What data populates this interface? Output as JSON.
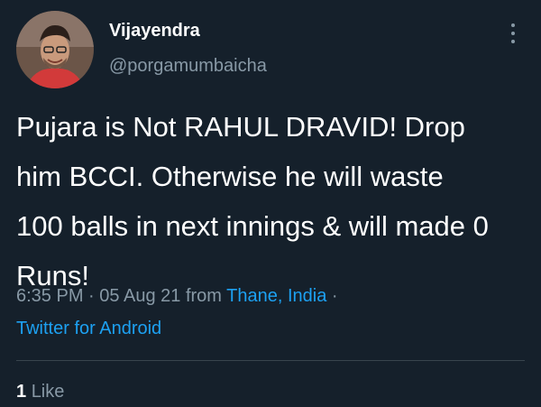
{
  "author": {
    "display_name": "Vijayendra",
    "handle": "@porgamumbaicha",
    "avatar_icon": "user-avatar"
  },
  "menu": {
    "icon": "more-vertical-icon"
  },
  "tweet": {
    "lines": [
      "Pujara is Not RAHUL DRAVID! Drop",
      "him BCCI. Otherwise he will waste",
      "100 balls in next innings & will made 0",
      "Runs!"
    ]
  },
  "meta": {
    "time": "6:35 PM",
    "sep1": "·",
    "date": "05 Aug 21",
    "from_label": "from",
    "location": "Thane, India",
    "sep2": "·",
    "source": "Twitter for Android"
  },
  "stats": {
    "likes_count": "1",
    "likes_label": "Like"
  },
  "colors": {
    "background": "#15202b",
    "text": "#ffffff",
    "secondary": "#8899a6",
    "link": "#1da1f2",
    "divider": "#38444d"
  }
}
